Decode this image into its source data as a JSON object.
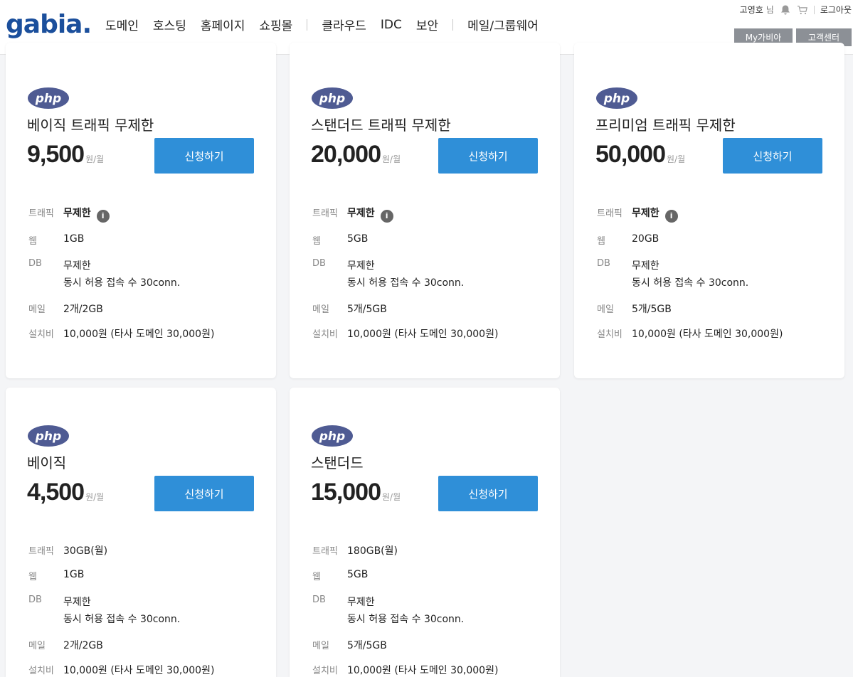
{
  "header": {
    "logo_text": "gabia.",
    "nav": [
      "도메인",
      "호스팅",
      "홈페이지",
      "쇼핑몰",
      "클라우드",
      "IDC",
      "보안",
      "메일/그룹웨어"
    ],
    "user_name": "고영호",
    "user_suffix": "님",
    "logout": "로그아웃",
    "my_gabia": "My가비아",
    "support": "고객센터"
  },
  "cards": [
    {
      "logo_text": "php",
      "name": "베이직 트래픽 무제한",
      "price": "9,500",
      "unit": "원/월",
      "apply": "신청하기",
      "specs": {
        "traffic_label": "트래픽",
        "traffic": "무제한",
        "web_label": "웹",
        "web": "1GB",
        "db_label": "DB",
        "db": "무제한",
        "db_conn": "동시 허용 접속 수 30conn.",
        "mail_label": "메일",
        "mail": "2개/2GB",
        "setup_label": "설치비",
        "setup": "10,000원 (타사 도메인 30,000원)"
      }
    },
    {
      "logo_text": "php",
      "name": "스탠더드 트래픽 무제한",
      "price": "20,000",
      "unit": "원/월",
      "apply": "신청하기",
      "specs": {
        "traffic_label": "트래픽",
        "traffic": "무제한",
        "web_label": "웹",
        "web": "5GB",
        "db_label": "DB",
        "db": "무제한",
        "db_conn": "동시 허용 접속 수 30conn.",
        "mail_label": "메일",
        "mail": "5개/5GB",
        "setup_label": "설치비",
        "setup": "10,000원 (타사 도메인 30,000원)"
      }
    },
    {
      "logo_text": "php",
      "name": "프리미엄 트래픽 무제한",
      "price": "50,000",
      "unit": "원/월",
      "apply": "신청하기",
      "specs": {
        "traffic_label": "트래픽",
        "traffic": "무제한",
        "web_label": "웹",
        "web": "20GB",
        "db_label": "DB",
        "db": "무제한",
        "db_conn": "동시 허용 접속 수 30conn.",
        "mail_label": "메일",
        "mail": "5개/5GB",
        "setup_label": "설치비",
        "setup": "10,000원 (타사 도메인 30,000원)"
      }
    },
    {
      "logo_text": "php",
      "name": "베이직",
      "price": "4,500",
      "unit": "원/월",
      "apply": "신청하기",
      "specs": {
        "traffic_label": "트래픽",
        "traffic": "30GB(월)",
        "web_label": "웹",
        "web": "1GB",
        "db_label": "DB",
        "db": "무제한",
        "db_conn": "동시 허용 접속 수 30conn.",
        "mail_label": "메일",
        "mail": "2개/2GB",
        "setup_label": "설치비",
        "setup": "10,000원 (타사 도메인 30,000원)"
      }
    },
    {
      "logo_text": "php",
      "name": "스탠더드",
      "price": "15,000",
      "unit": "원/월",
      "apply": "신청하기",
      "specs": {
        "traffic_label": "트래픽",
        "traffic": "180GB(월)",
        "web_label": "웹",
        "web": "5GB",
        "db_label": "DB",
        "db": "무제한",
        "db_conn": "동시 허용 접속 수 30conn.",
        "mail_label": "메일",
        "mail": "5개/5GB",
        "setup_label": "설치비",
        "setup": "10,000원 (타사 도메인 30,000원)"
      }
    }
  ],
  "colors": {
    "accent": "#2f8fd8",
    "logo_blue": "#1b4f9c",
    "php_blue": "#4f5b93",
    "gray_button": "#8c9096",
    "background": "#f4f5f7"
  },
  "icons": [
    "bell-icon",
    "cart-icon",
    "info-icon",
    "php-logo",
    "gabia-logo"
  ]
}
